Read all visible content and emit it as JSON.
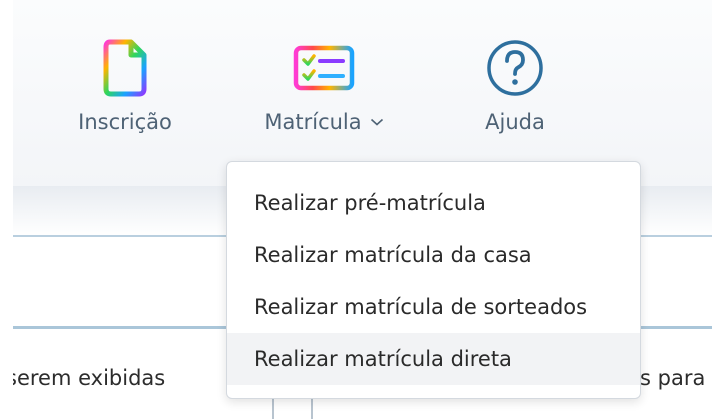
{
  "nav": {
    "inscricao": {
      "label": "Inscrição",
      "icon": "document-icon"
    },
    "matricula": {
      "label": "Matrícula",
      "icon": "checklist-icon"
    },
    "ajuda": {
      "label": "Ajuda",
      "icon": "help-circle-icon"
    }
  },
  "dropdown": {
    "items": [
      {
        "label": "Realizar pré-matrícula"
      },
      {
        "label": "Realizar matrícula da casa"
      },
      {
        "label": "Realizar matrícula de sorteados"
      },
      {
        "label": "Realizar matrícula direta",
        "hovered": true
      }
    ]
  },
  "content": {
    "left_text": "serem exibidas",
    "right_text": "s para"
  },
  "colors": {
    "nav_label": "#4e6275",
    "help_icon": "#2e6f9e",
    "rule": "#b9cfdf"
  }
}
